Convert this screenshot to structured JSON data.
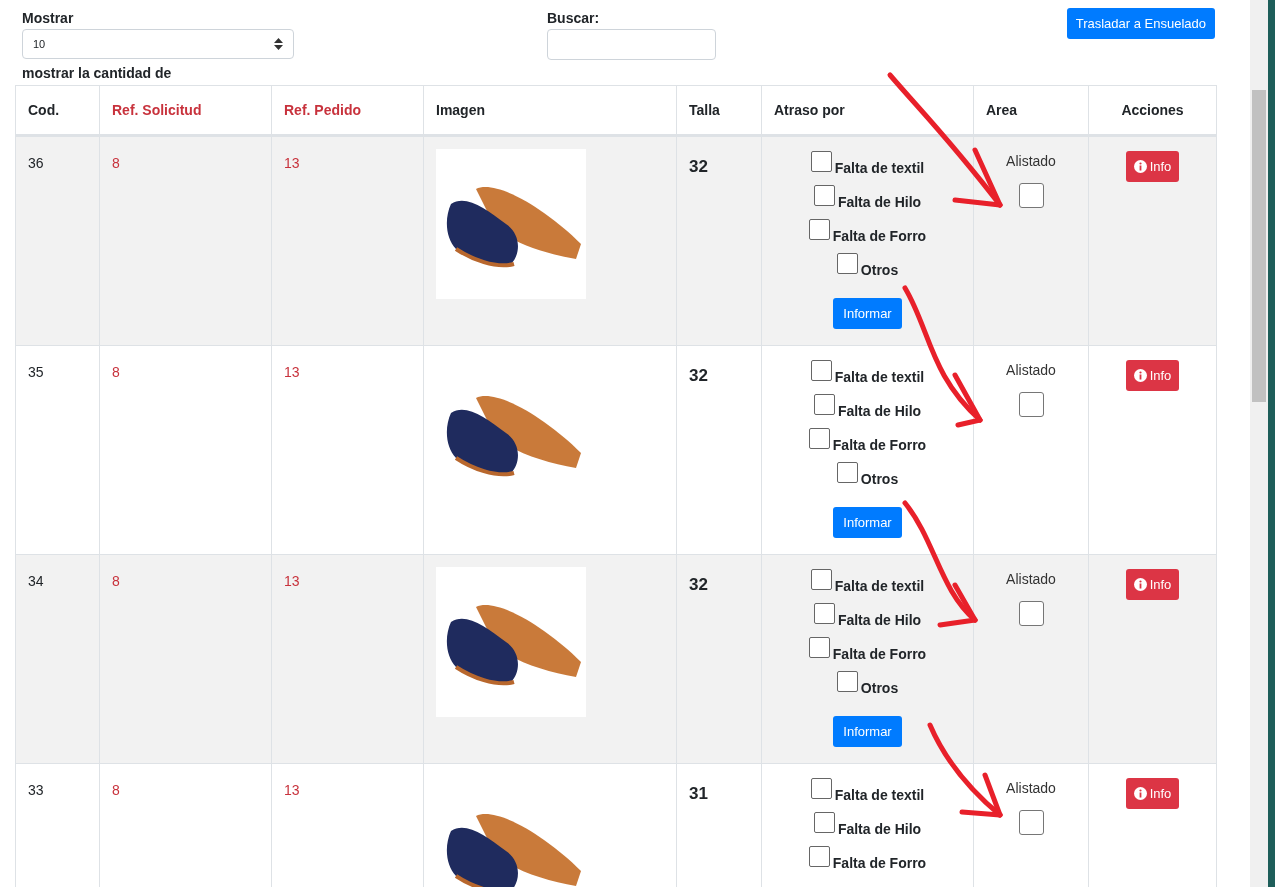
{
  "controls": {
    "length_label": "Mostrar",
    "length_value": "10",
    "length_caption": "mostrar la cantidad de",
    "search_label": "Buscar:",
    "transfer_button": "Trasladar a Ensuelado"
  },
  "table": {
    "columns": [
      {
        "label": "Cod.",
        "kind": "plain"
      },
      {
        "label": "Ref. Solicitud",
        "kind": "link"
      },
      {
        "label": "Ref. Pedido",
        "kind": "link"
      },
      {
        "label": "Imagen",
        "kind": "plain"
      },
      {
        "label": "Talla",
        "kind": "plain"
      },
      {
        "label": "Atraso por",
        "kind": "plain"
      },
      {
        "label": "Area",
        "kind": "plain"
      },
      {
        "label": "Acciones",
        "kind": "plain"
      }
    ],
    "rows": [
      {
        "cod": "36",
        "ref_solicitud": "8",
        "ref_pedido": "13",
        "talla": "32",
        "delays": [
          {
            "label": "Falta de textil",
            "checked": false
          },
          {
            "label": "Falta de Hilo",
            "checked": false
          },
          {
            "label": "Falta de Forro",
            "checked": false
          },
          {
            "label": "Otros",
            "checked": false
          }
        ],
        "report_button": "Informar",
        "area": {
          "label": "Alistado",
          "checked": false
        },
        "info_button": "Info"
      },
      {
        "cod": "35",
        "ref_solicitud": "8",
        "ref_pedido": "13",
        "talla": "32",
        "delays": [
          {
            "label": "Falta de textil",
            "checked": false
          },
          {
            "label": "Falta de Hilo",
            "checked": false
          },
          {
            "label": "Falta de Forro",
            "checked": false
          },
          {
            "label": "Otros",
            "checked": false
          }
        ],
        "report_button": "Informar",
        "area": {
          "label": "Alistado",
          "checked": false
        },
        "info_button": "Info"
      },
      {
        "cod": "34",
        "ref_solicitud": "8",
        "ref_pedido": "13",
        "talla": "32",
        "delays": [
          {
            "label": "Falta de textil",
            "checked": false
          },
          {
            "label": "Falta de Hilo",
            "checked": false
          },
          {
            "label": "Falta de Forro",
            "checked": false
          },
          {
            "label": "Otros",
            "checked": false
          }
        ],
        "report_button": "Informar",
        "area": {
          "label": "Alistado",
          "checked": false
        },
        "info_button": "Info"
      },
      {
        "cod": "33",
        "ref_solicitud": "8",
        "ref_pedido": "13",
        "talla": "31",
        "delays": [
          {
            "label": "Falta de textil",
            "checked": false
          },
          {
            "label": "Falta de Hilo",
            "checked": false
          },
          {
            "label": "Falta de Forro",
            "checked": false
          }
        ],
        "area": {
          "label": "Alistado",
          "checked": false
        },
        "info_button": "Info"
      }
    ]
  }
}
